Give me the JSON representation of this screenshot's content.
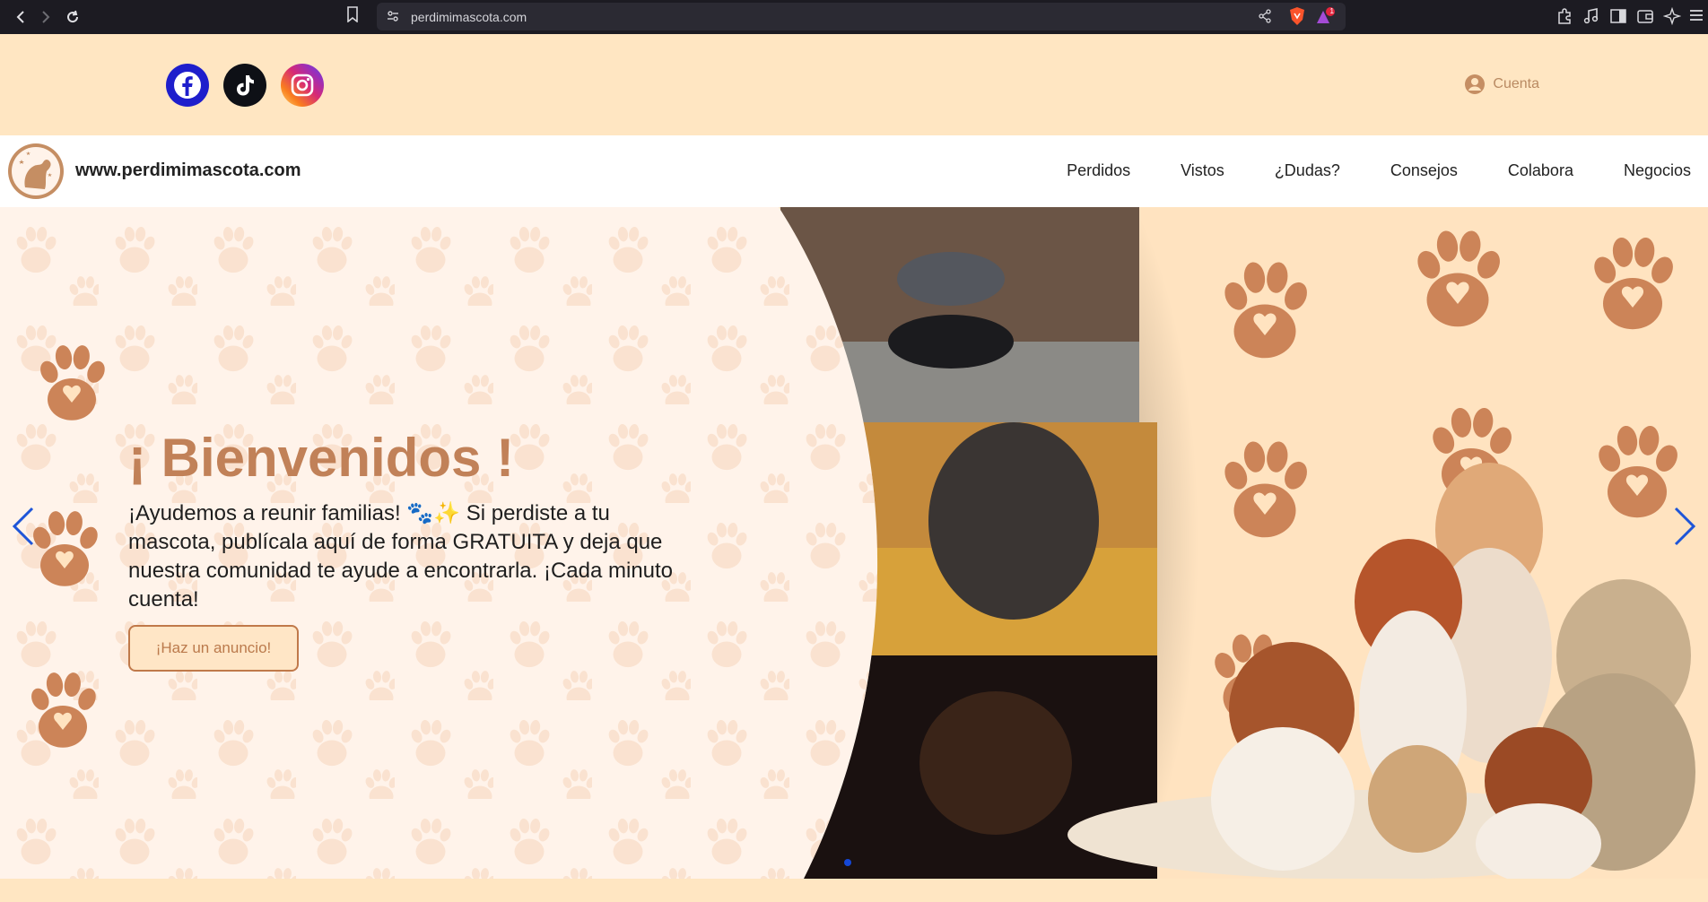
{
  "browser": {
    "url": "perdimimascota.com",
    "icons": [
      "back-icon",
      "forward-icon",
      "reload-icon",
      "bookmark-icon",
      "site-info-icon",
      "share-icon",
      "brave-shield-icon",
      "brave-rewards-icon",
      "extensions-icon",
      "media-icon",
      "sidebar-icon",
      "wallet-icon",
      "leo-ai-icon",
      "menu-icon"
    ],
    "notification_count": "1"
  },
  "topbar": {
    "socials": [
      "facebook-icon",
      "tiktok-icon",
      "instagram-icon"
    ],
    "account_label": "Cuenta"
  },
  "nav": {
    "brand": "www.perdimimascota.com",
    "items": [
      "Perdidos",
      "Vistos",
      "¿Dudas?",
      "Consejos",
      "Colabora",
      "Negocios"
    ]
  },
  "hero": {
    "title": "¡ Bienvenidos !",
    "intro": "¡Ayudemos a reunir familias! 🐾✨ Si perdiste a tu mascota, publícala aquí de forma GRATUITA y deja que nuestra comunidad te ayude a encontrarla. ¡Cada minuto cuenta!",
    "cta_label": "¡Haz un anuncio!",
    "slides_total": 1,
    "active_slide": 1
  },
  "colors": {
    "accent": "#c18158",
    "background": "#ffe6c2",
    "indicator": "#1447d6"
  }
}
